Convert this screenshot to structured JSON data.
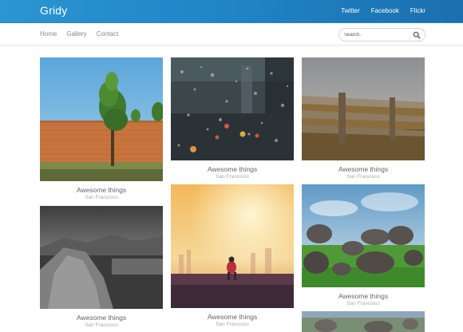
{
  "brand": "Gridy",
  "social": [
    {
      "label": "Twitter"
    },
    {
      "label": "Facebook"
    },
    {
      "label": "Flickr"
    }
  ],
  "nav": [
    {
      "label": "Home"
    },
    {
      "label": "Gallery"
    },
    {
      "label": "Contact"
    }
  ],
  "search": {
    "placeholder": "Search.."
  },
  "cards": [
    {
      "title": "Awesome things",
      "subtitle": "San Francisco",
      "image": "tree-brick-wall"
    },
    {
      "title": "Awesome things",
      "subtitle": "San Francisco",
      "image": "rainy-window"
    },
    {
      "title": "Awesome things",
      "subtitle": "San Francisco",
      "image": "wooden-fence"
    },
    {
      "title": "Awesome things",
      "subtitle": "San Francisco",
      "image": "black-white-rock"
    },
    {
      "title": "Awesome things",
      "subtitle": "San Francisco",
      "image": "sunset-runner"
    },
    {
      "title": "Awesome things",
      "subtitle": "San Francisco",
      "image": "stone-circle"
    },
    {
      "title": "",
      "subtitle": "",
      "image": "stone-field-partial"
    }
  ]
}
